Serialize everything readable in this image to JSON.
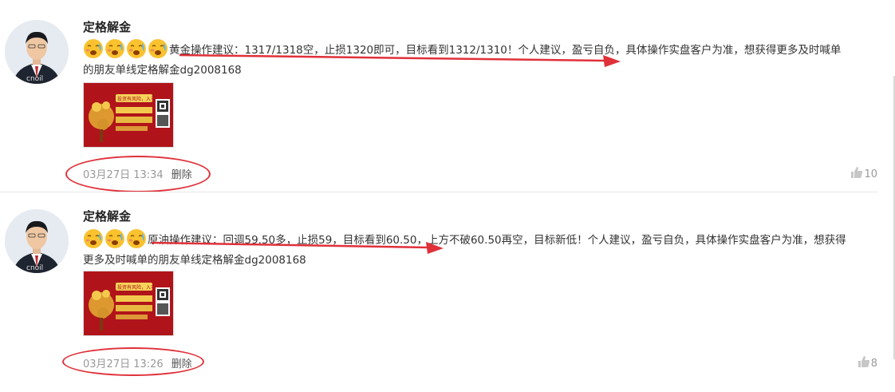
{
  "posts": [
    {
      "author": "定格解金",
      "text_line1": "黄金操作建议：1317/1318空，止损1320即可，目标看到1312/1310！个人建议，盈亏自负，具体操作实盘客户为准，想获得更多及时喊单",
      "text_line2": "的朋友单线定格解金dg2008168",
      "emoji_count": 4,
      "time": "03月27日 13:34",
      "delete_label": "删除",
      "likes": "10",
      "avatar_watermark": "cnoil",
      "thumb_badge": "投资有风险，入市需谨慎"
    },
    {
      "author": "定格解金",
      "text_line1": "原油操作建议：回调59.50多，止损59，目标看到60.50，上方不破60.50再空，目标新低！个人建议，盈亏自负，具体操作实盘客户为准，想获得",
      "text_line2": "更多及时喊单的朋友单线定格解金dg2008168",
      "emoji_count": 3,
      "time": "03月27日 13:26",
      "delete_label": "删除",
      "likes": "8",
      "avatar_watermark": "cnoil",
      "thumb_badge": "投资有风险，入市需谨慎"
    }
  ],
  "colors": {
    "annotation_red": "#e0313b",
    "thumb_red": "#b0141a",
    "meta_gray": "#999999"
  }
}
